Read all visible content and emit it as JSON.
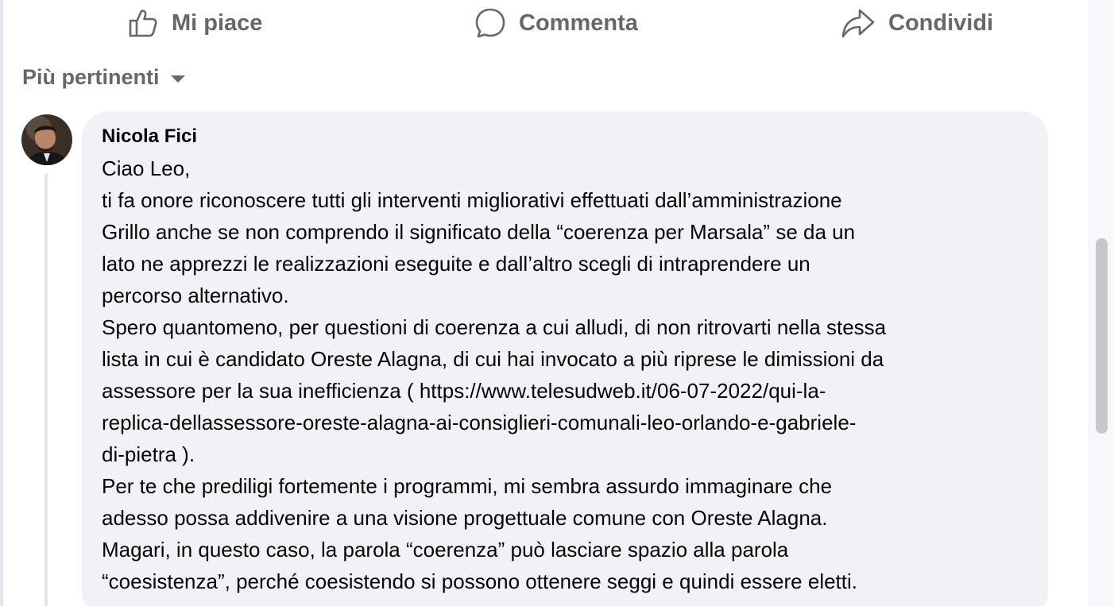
{
  "actions": {
    "like_label": "Mi piace",
    "comment_label": "Commenta",
    "share_label": "Condividi"
  },
  "sort": {
    "label": "Più pertinenti"
  },
  "comment": {
    "author": "Nicola Fici",
    "lines": [
      "Ciao Leo,",
      "ti fa onore riconoscere tutti gli interventi migliorativi effettuati dall’amministrazione",
      "Grillo anche se non comprendo il significato della “coerenza per Marsala” se da un",
      "lato ne apprezzi le realizzazioni eseguite e dall’altro scegli di intraprendere un",
      "percorso alternativo.",
      "Spero quantomeno, per questioni di coerenza a cui alludi, di non ritrovarti nella stessa",
      "lista in cui è candidato Oreste Alagna, di cui hai invocato a più riprese le dimissioni da",
      "assessore per la sua inefficienza ( https://www.telesudweb.it/06-07-2022/qui-la-",
      "replica-dellassessore-oreste-alagna-ai-consiglieri-comunali-leo-orlando-e-gabriele-",
      "di-pietra ).",
      "Per te che prediligi fortemente i programmi, mi sembra assurdo immaginare che",
      "adesso possa addivenire a una visione progettuale comune con Oreste Alagna.",
      "Magari, in questo caso, la parola “coerenza” può lasciare spazio alla parola",
      "“coesistenza”, perché coesistendo si possono ottenere seggi e quindi essere eletti."
    ]
  },
  "icons": {
    "like": "thumbs-up-icon",
    "comment": "speech-bubble-icon",
    "share": "share-arrow-icon",
    "sort": "caret-down-icon"
  },
  "colors": {
    "action_text": "#65676b",
    "bubble_bg": "#f0f2f5",
    "text": "#050505"
  }
}
